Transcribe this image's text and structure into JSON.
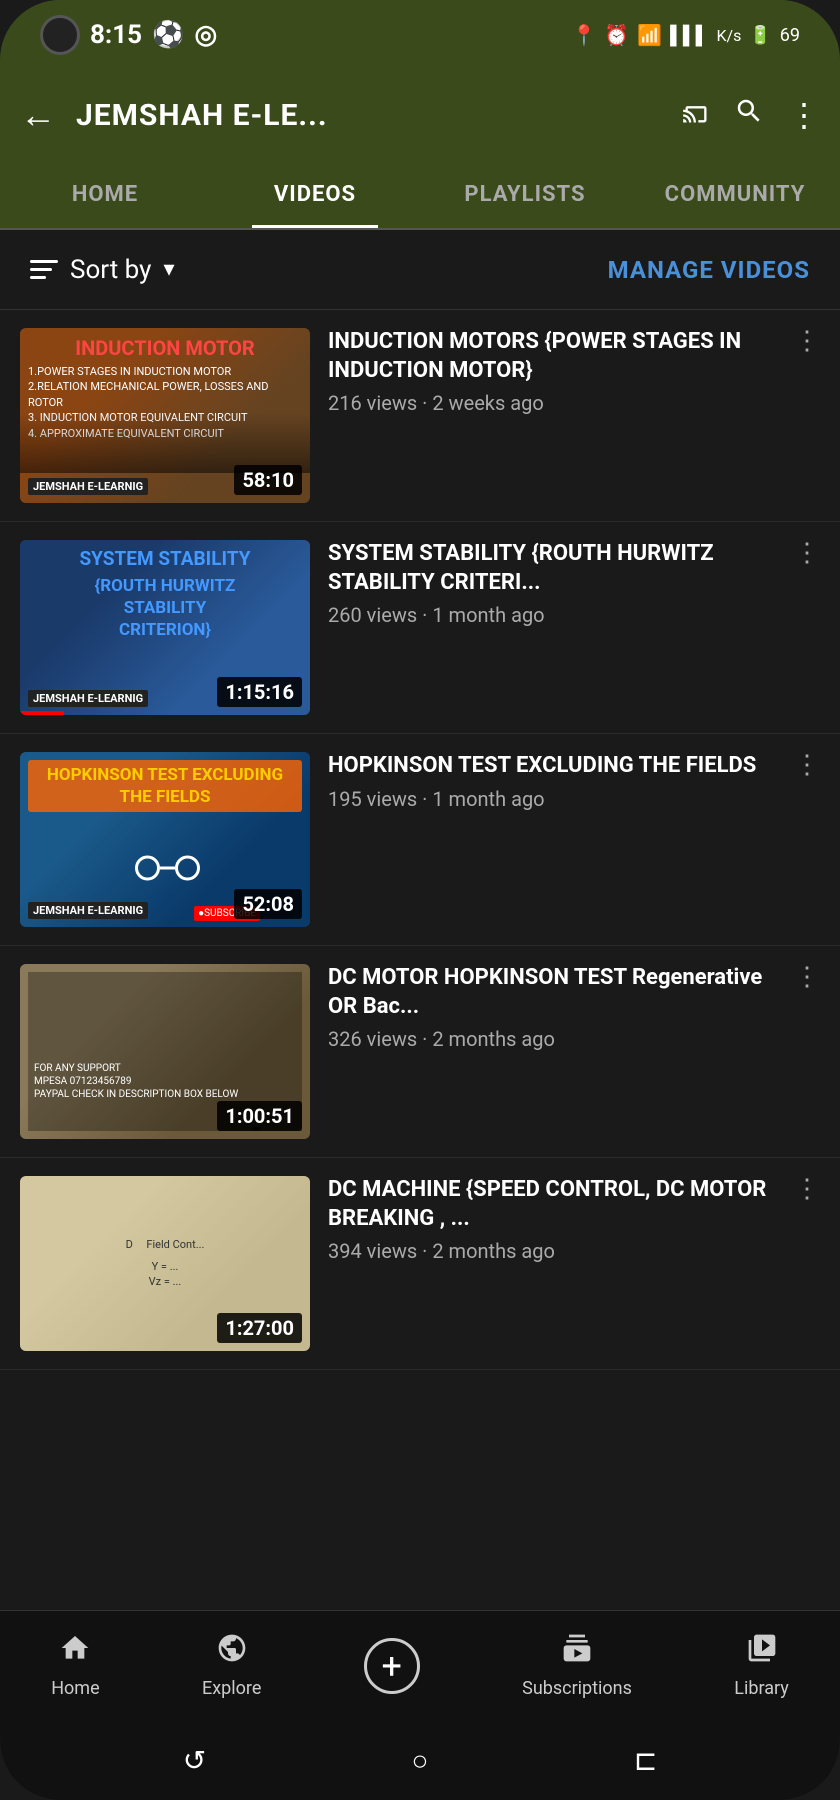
{
  "statusBar": {
    "time": "8:15",
    "icons": [
      "⚽",
      "◎"
    ],
    "rightIcons": [
      "📍",
      "⏰",
      "wifi",
      "signal1",
      "signal2",
      "speed",
      "battery"
    ],
    "batteryLevel": "69"
  },
  "header": {
    "title": "JEMSHAH E-LE...",
    "backIcon": "←",
    "castIcon": "cast",
    "searchIcon": "search",
    "moreIcon": "⋮"
  },
  "tabs": [
    {
      "id": "home",
      "label": "HOME",
      "active": false
    },
    {
      "id": "videos",
      "label": "VIDEOS",
      "active": true
    },
    {
      "id": "playlists",
      "label": "PLAYLISTS",
      "active": false
    },
    {
      "id": "community",
      "label": "COMMUNITY",
      "active": false
    }
  ],
  "sortBar": {
    "label": "Sort by",
    "manageVideos": "MANAGE VIDEOS"
  },
  "videos": [
    {
      "title": "INDUCTION MOTORS {POWER STAGES IN INDUCTION MOTOR}",
      "thumbTitle": "INDUCTION MOTOR",
      "thumbSubLines": [
        "1.POWER STAGES IN INDUCTION MOTOR",
        "2.RELATION MECHANICAL POWER, LOSSES AND ROTOR",
        "3. INDUCTION MOTOR EQUIVALENT CIRCUIT",
        "4. APPROXIMATE EQUIVALENT CIRCUIT"
      ],
      "duration": "58:10",
      "views": "216 views",
      "timeAgo": "2 weeks ago",
      "thumbClass": "thumb1",
      "redBarWidth": "0%"
    },
    {
      "title": "SYSTEM STABILITY {ROUTH   HURWITZ STABILITY CRITERI...",
      "thumbTitle": "SYSTEM STABILITY",
      "thumbSubLines": [
        "{ROUTH HURWITZ",
        "STABILITY",
        "CRITERION}"
      ],
      "duration": "1:15:16",
      "views": "260 views",
      "timeAgo": "1 month ago",
      "thumbClass": "thumb2",
      "redBarWidth": "15%"
    },
    {
      "title": "HOPKINSON TEST EXCLUDING THE FIELDS",
      "thumbTitle": "HOPKINSON TEST EXCLUDING THE FIELDS",
      "thumbSubLines": [],
      "duration": "52:08",
      "views": "195 views",
      "timeAgo": "1 month ago",
      "thumbClass": "thumb3",
      "redBarWidth": "0%"
    },
    {
      "title": "DC MOTOR HOPKINSON TEST Regenerative OR Bac...",
      "thumbTitle": "",
      "thumbSubLines": [],
      "duration": "1:00:51",
      "views": "326 views",
      "timeAgo": "2 months ago",
      "thumbClass": "thumb4",
      "redBarWidth": "0%"
    },
    {
      "title": "DC MACHINE {SPEED CONTROL, DC MOTOR BREAKING , ...",
      "thumbTitle": "",
      "thumbSubLines": [],
      "duration": "1:27:00",
      "views": "394 views",
      "timeAgo": "2 months ago",
      "thumbClass": "thumb5",
      "redBarWidth": "0%"
    }
  ],
  "bottomNav": [
    {
      "id": "home",
      "icon": "🏠",
      "label": "Home"
    },
    {
      "id": "explore",
      "icon": "🧭",
      "label": "Explore"
    },
    {
      "id": "add",
      "icon": "+",
      "label": ""
    },
    {
      "id": "subscriptions",
      "icon": "📺",
      "label": "Subscriptions"
    },
    {
      "id": "library",
      "icon": "📚",
      "label": "Library"
    }
  ],
  "sysNav": {
    "back": "↺",
    "home": "○",
    "recent": "⊏"
  }
}
